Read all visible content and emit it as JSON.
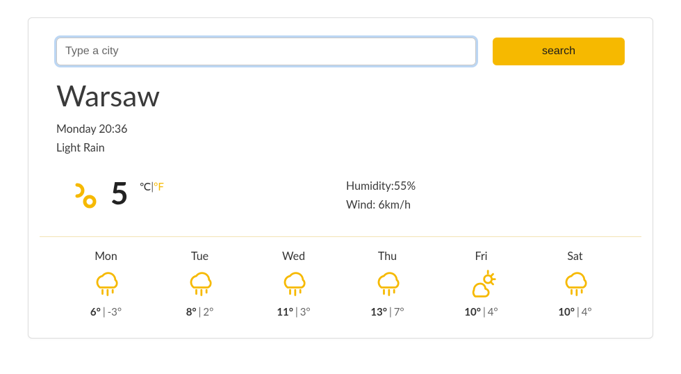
{
  "search": {
    "placeholder": "Type a city",
    "button": "search"
  },
  "city": "Warsaw",
  "datetime": "Monday 20:36",
  "condition": "Light Rain",
  "current": {
    "temp": "5",
    "unit_c": "℃",
    "unit_sep": "|",
    "unit_f": "°F",
    "humidity_label": "Humidity:",
    "humidity_value": "55%",
    "wind_label": "Wind: ",
    "wind_value": "6km/h"
  },
  "forecast": [
    {
      "day": "Mon",
      "icon": "rain",
      "hi": "6°",
      "lo": "-3°"
    },
    {
      "day": "Tue",
      "icon": "rain",
      "hi": "8°",
      "lo": "2°"
    },
    {
      "day": "Wed",
      "icon": "rain",
      "hi": "11°",
      "lo": "3°"
    },
    {
      "day": "Thu",
      "icon": "rain",
      "hi": "13°",
      "lo": "7°"
    },
    {
      "day": "Fri",
      "icon": "partly",
      "hi": "10°",
      "lo": "4°"
    },
    {
      "day": "Sat",
      "icon": "rain",
      "hi": "10°",
      "lo": "4°"
    }
  ]
}
